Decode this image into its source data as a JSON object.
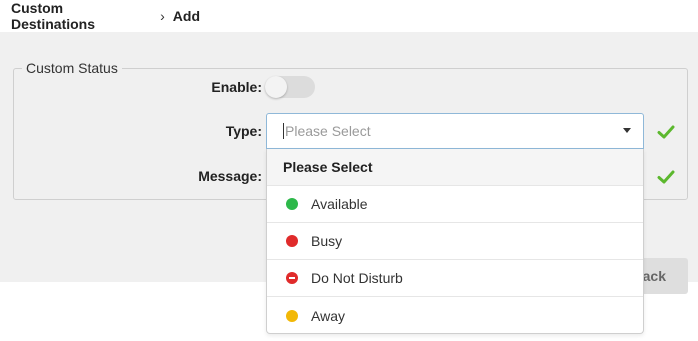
{
  "breadcrumb": {
    "parent": "Custom Destinations",
    "current": "Add"
  },
  "form": {
    "legend": "Custom Status",
    "enable_label": "Enable:",
    "enable_value": false,
    "type_label": "Type:",
    "type_placeholder": "Please Select",
    "message_label": "Message:"
  },
  "dropdown": {
    "header": "Please Select",
    "options": [
      {
        "label": "Available",
        "color": "#2db84a",
        "icon": "available-status-icon"
      },
      {
        "label": "Busy",
        "color": "#e02b2b",
        "icon": "busy-status-icon"
      },
      {
        "label": "Do Not Disturb",
        "color": "#e02b2b",
        "icon": "do-not-disturb-icon"
      },
      {
        "label": "Away",
        "color": "#f2b807",
        "icon": "away-status-icon"
      }
    ]
  },
  "buttons": {
    "back_label": "ack"
  },
  "colors": {
    "check": "#5cb82e",
    "panel_bg": "#f0f0f0",
    "select_border": "#8fb8d8"
  }
}
